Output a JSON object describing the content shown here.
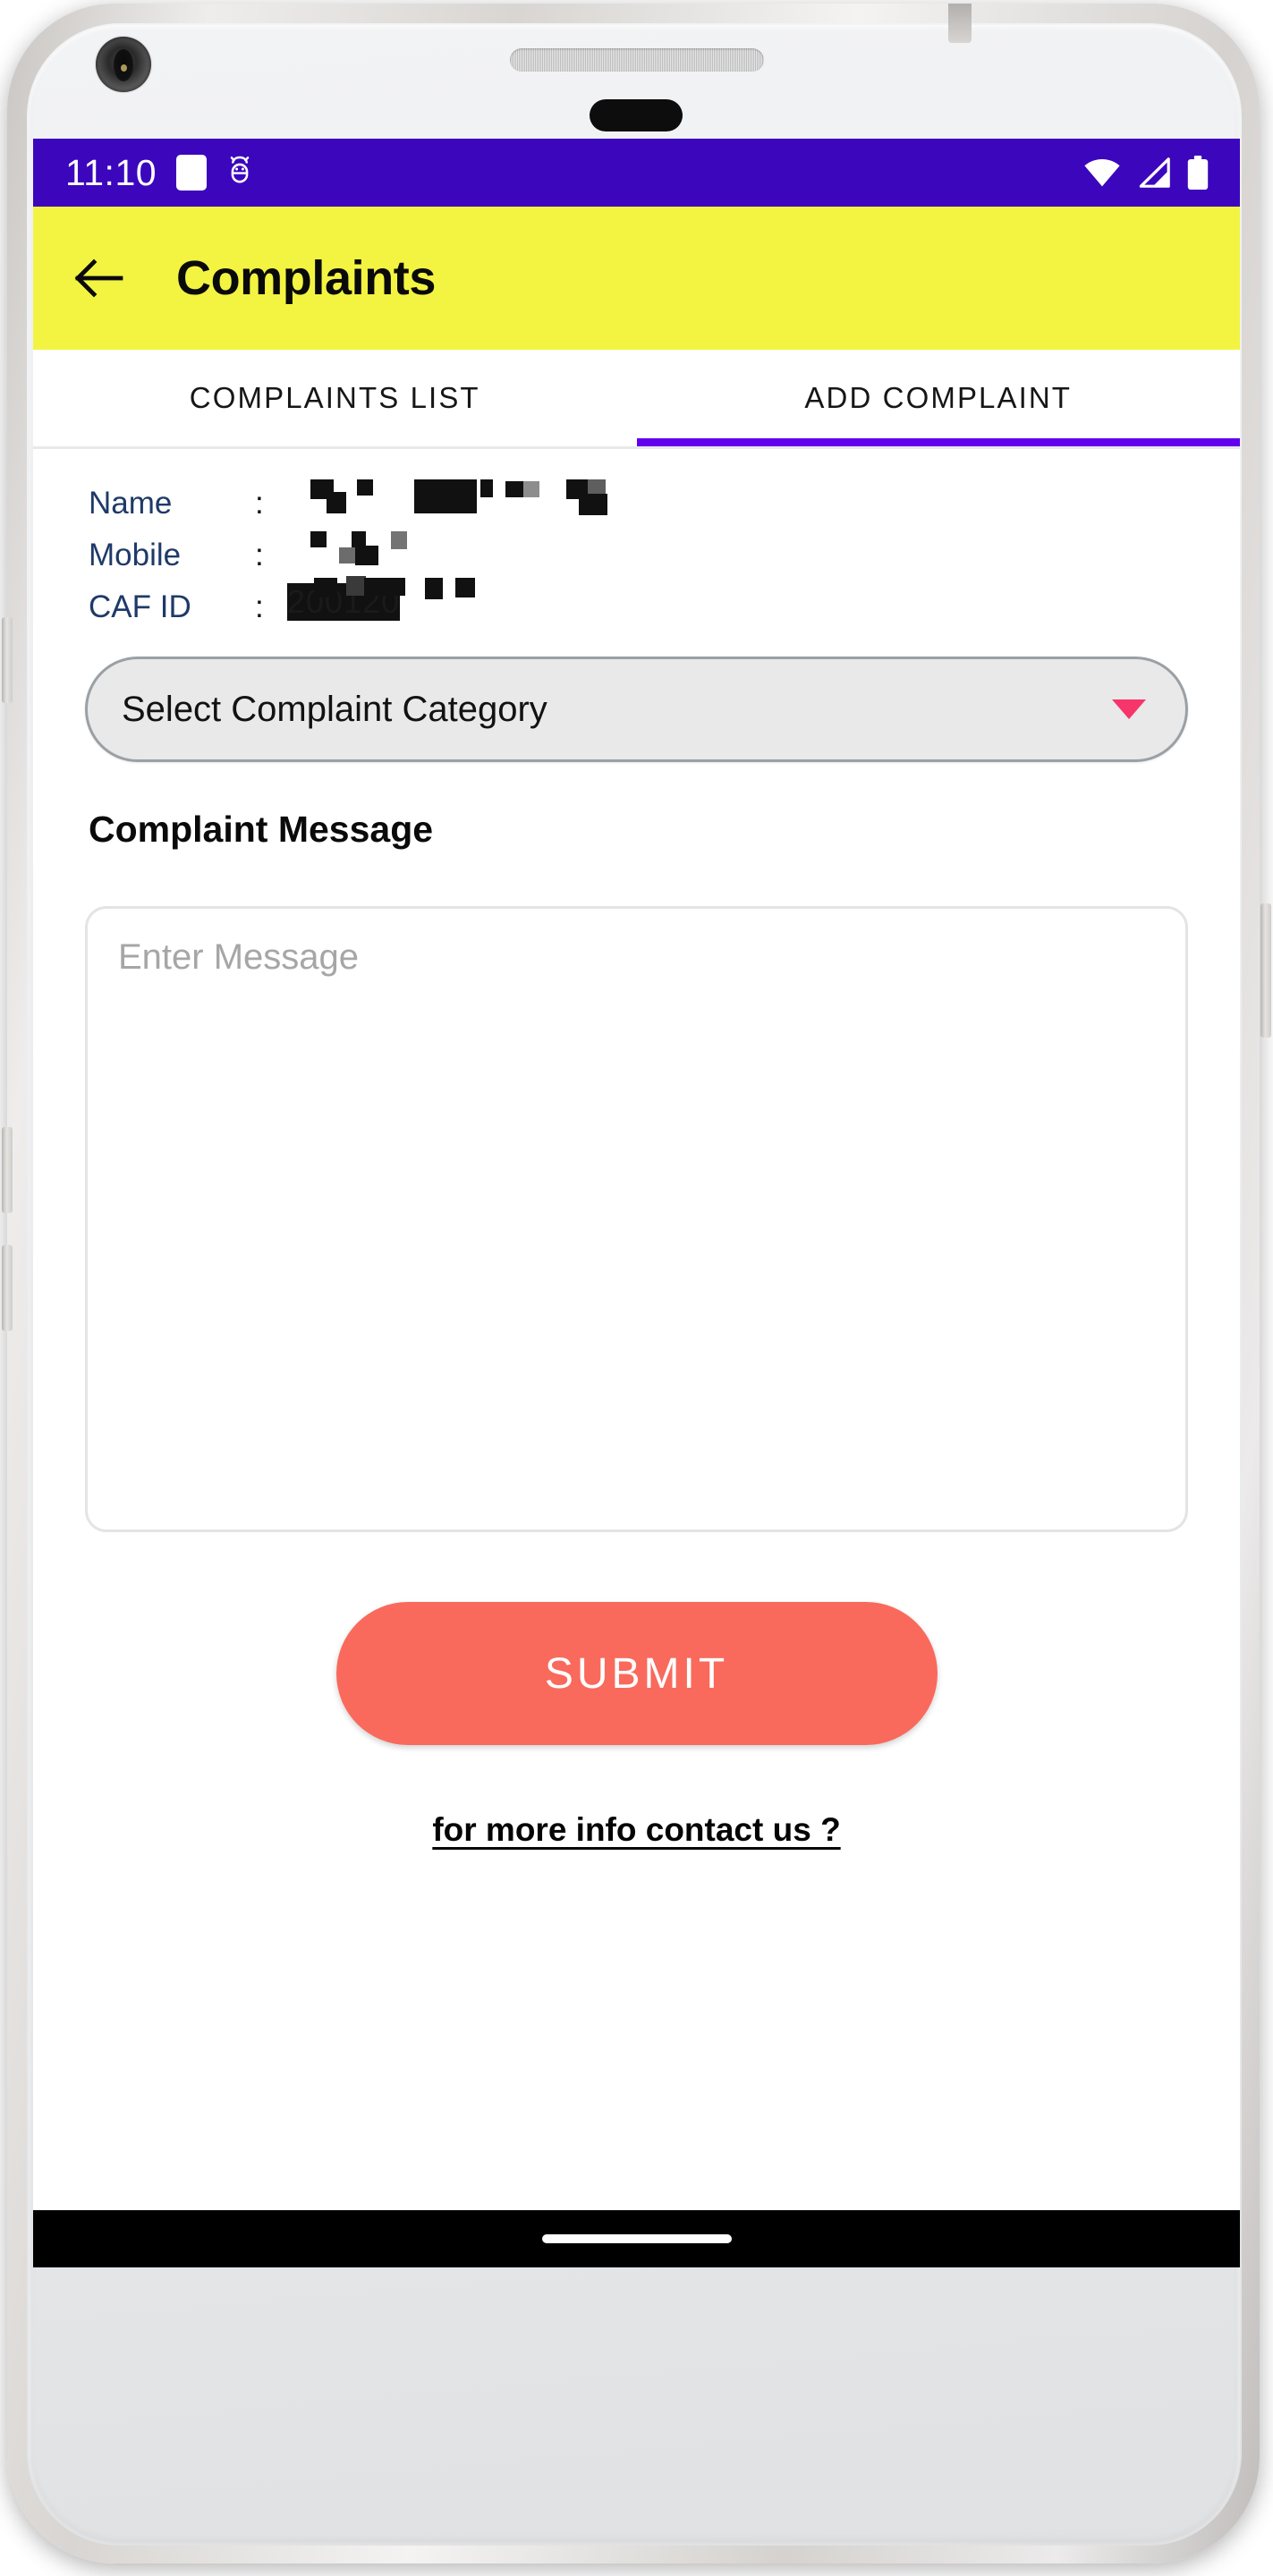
{
  "status_bar": {
    "time": "11:10",
    "icons": [
      "notification-square-icon",
      "android-debug-icon",
      "wifi-icon",
      "cellular-signal-icon",
      "battery-icon"
    ]
  },
  "app_bar": {
    "back_label": "back-arrow",
    "title": "Complaints",
    "background": "#f3f442"
  },
  "tabs": [
    {
      "label": "COMPLAINTS LIST",
      "active": false
    },
    {
      "label": "ADD COMPLAINT",
      "active": true
    }
  ],
  "tab_indicator_color": "#6200ee",
  "user_info": {
    "rows": [
      {
        "label": "Name",
        "separator": ":",
        "value": "",
        "redacted": true
      },
      {
        "label": "Mobile",
        "separator": ":",
        "value": "",
        "redacted": true
      },
      {
        "label": "CAF ID",
        "separator": ":",
        "value": "200120",
        "redacted": true
      }
    ]
  },
  "category_dropdown": {
    "selected_label": "Select Complaint Category",
    "caret_color": "#f6356b",
    "background": "#e9e9e9"
  },
  "message_section": {
    "heading": "Complaint Message",
    "placeholder": "Enter Message",
    "value": ""
  },
  "submit": {
    "label": "SUBMIT",
    "color": "#f96a5c"
  },
  "footer": {
    "contact_link": "for more info contact us ?"
  },
  "nav_bar": {
    "home_indicator": "home-indicator"
  }
}
